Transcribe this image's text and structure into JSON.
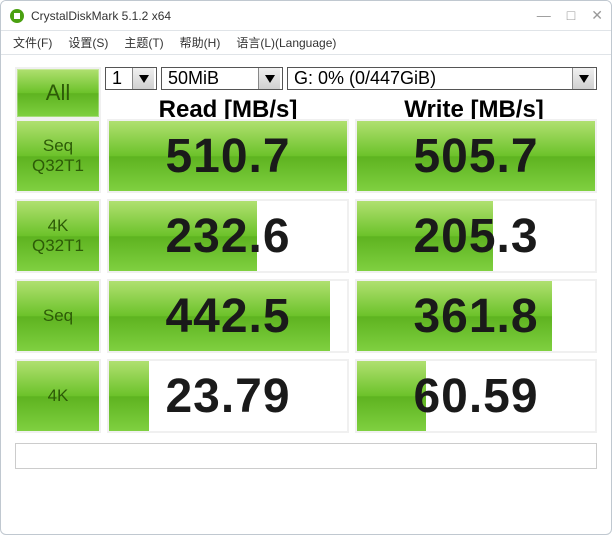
{
  "window": {
    "title": "CrystalDiskMark 5.1.2 x64",
    "min": "—",
    "max": "□",
    "close": "✕"
  },
  "menu": {
    "file": "文件(F)",
    "settings": "设置(S)",
    "theme": "主题(T)",
    "help": "帮助(H)",
    "language": "语言(L)(Language)"
  },
  "controls": {
    "all": "All",
    "count": "1",
    "size": "50MiB",
    "drive": "G: 0% (0/447GiB)"
  },
  "headers": {
    "read": "Read [MB/s]",
    "write": "Write [MB/s]"
  },
  "tests": [
    {
      "label1": "Seq",
      "label2": "Q32T1",
      "read": "510.7",
      "read_fill": 100,
      "write": "505.7",
      "write_fill": 100
    },
    {
      "label1": "4K",
      "label2": "Q32T1",
      "read": "232.6",
      "read_fill": 62,
      "write": "205.3",
      "write_fill": 57
    },
    {
      "label1": "Seq",
      "label2": "",
      "read": "442.5",
      "read_fill": 93,
      "write": "361.8",
      "write_fill": 82
    },
    {
      "label1": "4K",
      "label2": "",
      "read": "23.79",
      "read_fill": 17,
      "write": "60.59",
      "write_fill": 29
    }
  ]
}
